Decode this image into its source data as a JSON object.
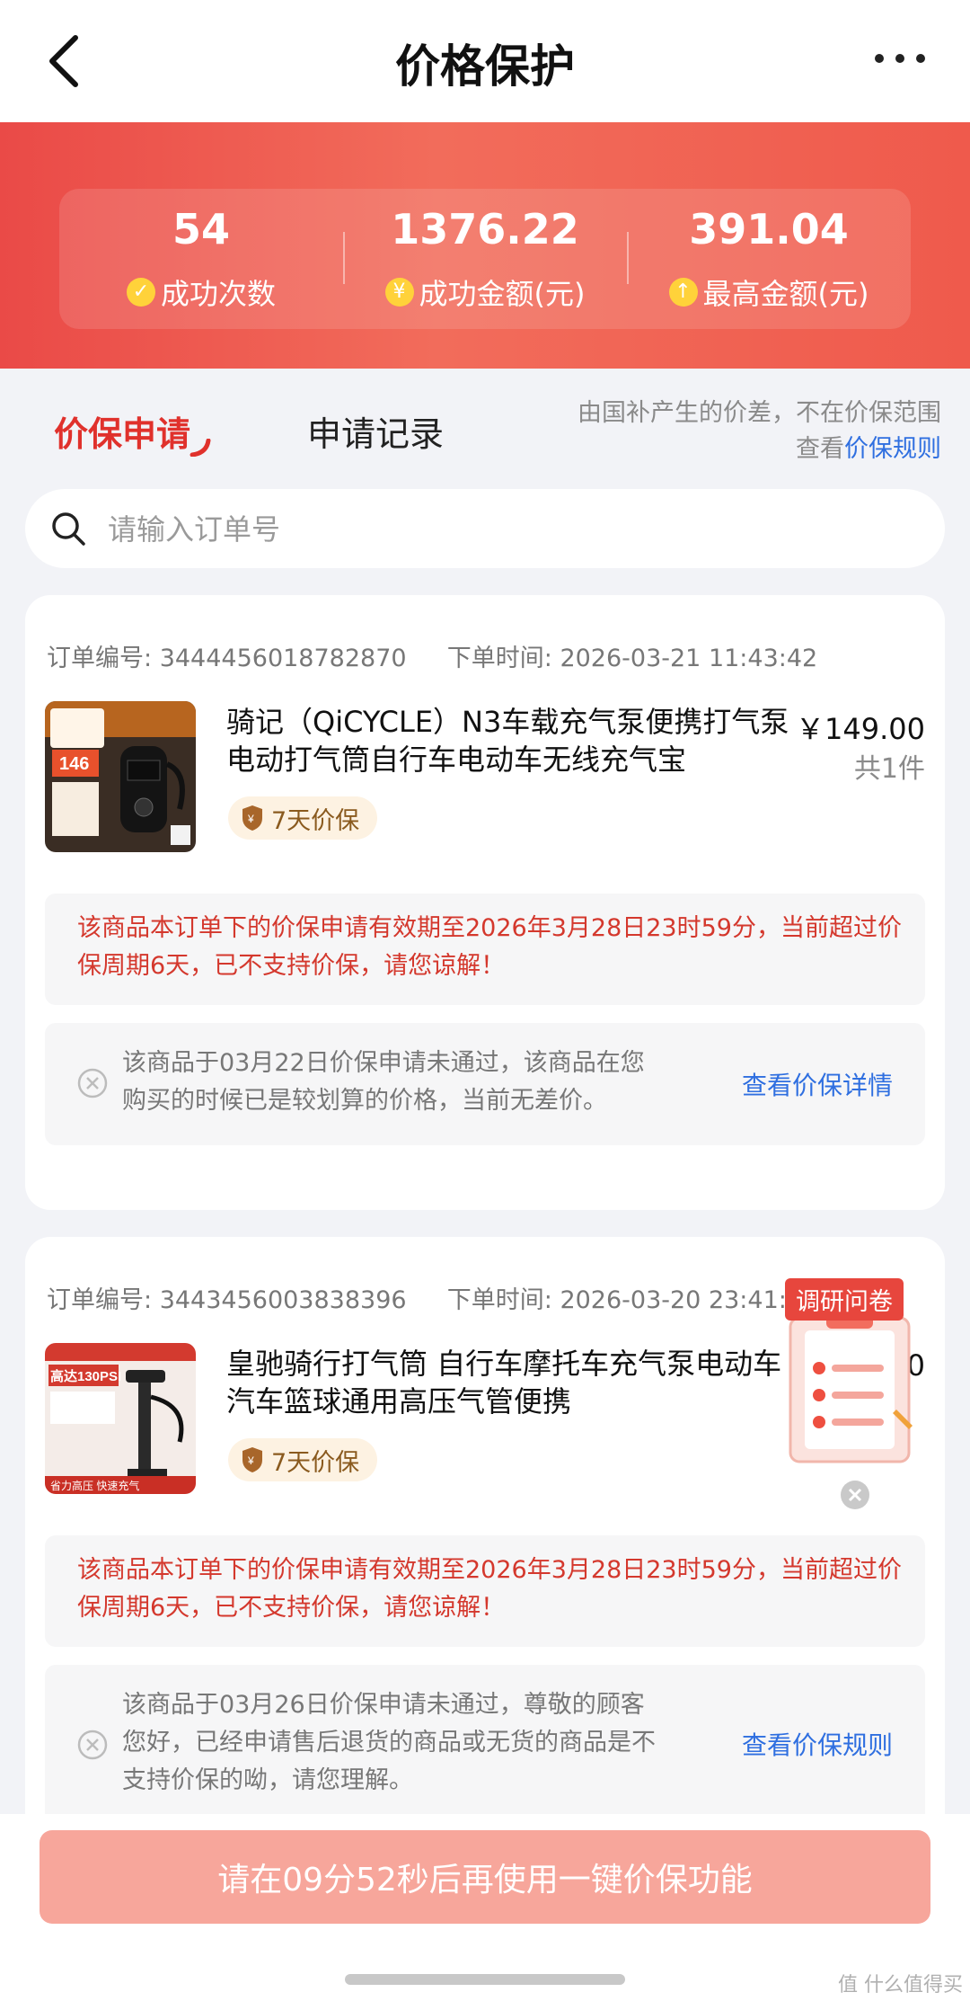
{
  "header": {
    "title": "价格保护"
  },
  "stats": [
    {
      "value": "54",
      "label": "成功次数",
      "icon": "check-icon"
    },
    {
      "value": "1376.22",
      "label": "成功金额(元)",
      "icon": "yuan-icon"
    },
    {
      "value": "391.04",
      "label": "最高金额(元)",
      "icon": "up-arrow-icon"
    }
  ],
  "tabs": [
    {
      "label": "价保申请",
      "active": true
    },
    {
      "label": "申请记录",
      "active": false
    }
  ],
  "notice": {
    "line1": "由国补产生的价差，不在价保范围",
    "line2_prefix": "查看",
    "line2_link": "价保规则"
  },
  "search": {
    "placeholder": "请输入订单号"
  },
  "orders": [
    {
      "order_no_label": "订单编号:",
      "order_no": "3444456018782870",
      "time_label": "下单时间:",
      "time": "2026-03-21 11:43:42",
      "title": "骑记（QiCYCLE）N3车载充气泵便携打气泵电动打气筒自行车电动车无线充气宝",
      "price": "￥149.00",
      "qty": "共1件",
      "badge": "7天价保",
      "warning": "该商品本订单下的价保申请有效期至2026年3月28日23时59分，当前超过价保周期6天，已不支持价保，请您谅解！",
      "info": "该商品于03月22日价保申请未通过，该商品在您购买的时候已是较划算的价格，当前无差价。",
      "info_link": "查看价保详情"
    },
    {
      "order_no_label": "订单编号:",
      "order_no": "3443456003838396",
      "time_label": "下单时间:",
      "time": "2026-03-20 23:41:18",
      "title": "皇驰骑行打气筒 自行车摩托车充气泵电动车汽车篮球通用高压气管便携",
      "price": "0",
      "qty": "",
      "badge": "7天价保",
      "warning": "该商品本订单下的价保申请有效期至2026年3月28日23时59分，当前超过价保周期6天，已不支持价保，请您谅解！",
      "info": "该商品于03月26日价保申请未通过，尊敬的顾客您好，已经申请售后退货的商品或无货的商品是不支持价保的呦，请您理解。",
      "info_link": "查看价保规则"
    }
  ],
  "thumbs": {
    "t1_tag": "146",
    "t2_line1": "高达130PSI",
    "t2_footer": "省力高压 快速充气"
  },
  "survey": {
    "tag": "调研问卷"
  },
  "cta": {
    "label": "请在09分52秒后再使用一键价保功能"
  },
  "watermark": "值 什么值得买",
  "colors": {
    "accent": "#e0312c",
    "link": "#2f6fe0",
    "banner": "#ef5a4c",
    "cta": "#f7a69b"
  }
}
